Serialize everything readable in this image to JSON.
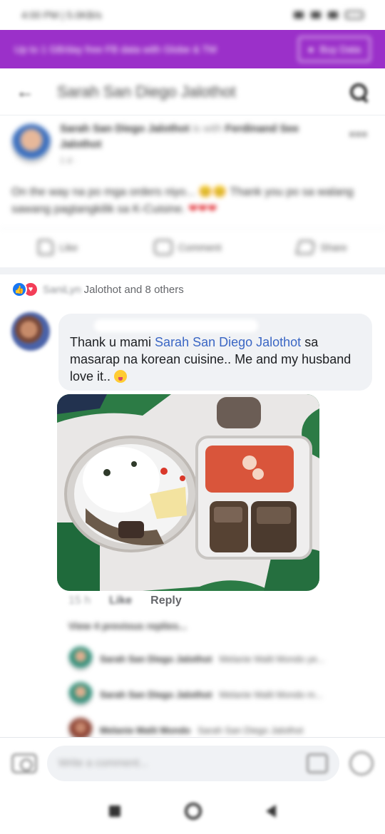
{
  "status_bar": {
    "time": "4:00 PM | 5.0KB/s"
  },
  "promo": {
    "text": "Up to 1 GB/day free FB data with Globe & TM",
    "button": "Buy Data"
  },
  "header": {
    "title": "Sarah San Diego Jalothot"
  },
  "post": {
    "author": "Sarah San Diego Jalothot",
    "with_text": "is with",
    "tagged": "Ferdinand See Jalothot",
    "meta": "1 d · ",
    "text": "On the way na po mga orders niyo... 😊😊 Thank you po sa walang sawang pagtangkilik sa K-Cuisine.",
    "hearts": "❤❤❤",
    "actions": {
      "like": "Like",
      "comment": "Comment",
      "share": "Share"
    }
  },
  "reactions": {
    "first": "SaniLyn",
    "rest": "Jalothot and 8 others"
  },
  "comment": {
    "lead": "Thank u mami ",
    "mention": "Sarah San Diego Jalothot",
    "body": " sa masarap na korean cuisine.. Me and my husband love it.. ",
    "time": "15 h",
    "like": "Like",
    "reply": "Reply"
  },
  "view_previous": "View 4 previous replies...",
  "replies": [
    {
      "name": "Sarah San Diego Jalothot",
      "text": "Melanie Malit Mondo ye..."
    },
    {
      "name": "Sarah San Diego Jalothot",
      "text": "Melanie Malit Mondo m..."
    },
    {
      "name": "Melanie Malit Mondo",
      "text": "Sarah San Diego Jalothot"
    }
  ],
  "composer": {
    "placeholder": "Write a comment..."
  },
  "colors": {
    "promo": "#9b30c9",
    "mention": "#3a66c4",
    "like_blue": "#1877f2",
    "love_red": "#f33e58"
  },
  "icons": [
    "back-arrow-icon",
    "search-icon",
    "more-icon",
    "like-icon",
    "comment-icon",
    "share-icon",
    "camera-icon",
    "gif-icon",
    "sticker-icon"
  ]
}
